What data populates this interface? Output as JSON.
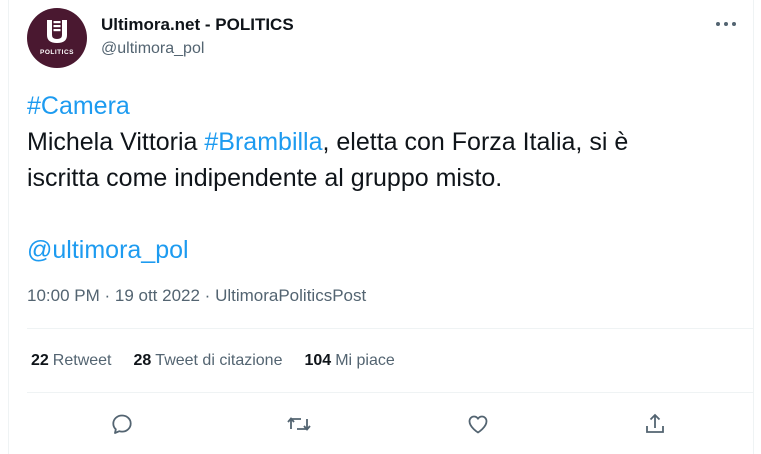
{
  "author": {
    "display_name": "Ultimora.net - POLITICS",
    "handle": "@ultimora_pol",
    "avatar_text": "POLITICS"
  },
  "tweet": {
    "hashtag_camera": "#Camera",
    "line2_a": "Michela Vittoria ",
    "hashtag_brambilla": "#Brambilla",
    "line2_b": ", eletta con Forza Italia, si è",
    "line3": "iscritta come indipendente al gruppo misto.",
    "mention": "@ultimora_pol"
  },
  "meta": {
    "time": "10:00 PM",
    "sep1": " · ",
    "date": "19 ott 2022",
    "sep2": " · ",
    "source": "UltimoraPoliticsPost"
  },
  "stats": {
    "retweets_count": "22",
    "retweets_label": "Retweet",
    "quotes_count": "28",
    "quotes_label": "Tweet di citazione",
    "likes_count": "104",
    "likes_label": "Mi piace"
  },
  "icons": {
    "more": "more-dots-icon",
    "reply": "reply-icon",
    "retweet": "retweet-icon",
    "like": "heart-icon",
    "share": "share-icon"
  },
  "colors": {
    "link": "#1d9bf0",
    "secondary_text": "#536471",
    "avatar_bg": "#4a1830",
    "divider": "#eff3f4"
  }
}
